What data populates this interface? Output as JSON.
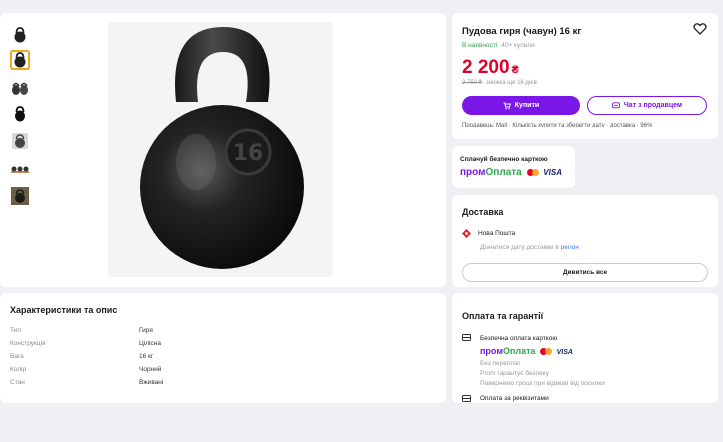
{
  "gallery": {
    "thumbnails": [
      "thumb-1",
      "thumb-2",
      "thumb-3",
      "thumb-4",
      "thumb-5",
      "thumb-6",
      "thumb-7"
    ],
    "main_image_label": "16"
  },
  "product": {
    "title": "Пудова гиря (чавун) 16 кг",
    "in_stock": "В наявності",
    "bought": "40+ купили",
    "price": "2 200",
    "currency": "₴",
    "old_price": "2 750 ₴",
    "discount_note": "знижка ще 16 днів",
    "buy_label": "Купити",
    "chat_label": "Чат з продавцем",
    "cut_text": "Продавець: Mall · Кількість купити та зберегти дату · доставка · 96%"
  },
  "safe_pay": {
    "title": "Сплачуй безпечно карткою",
    "prom_1": "пром",
    "prom_2": "Оплата",
    "visa": "VISA"
  },
  "delivery": {
    "title": "Доставка",
    "carrier": "Нова Пошта",
    "note": "Дізнатися дату доставки в",
    "note_link": "регіон",
    "view_all": "Дивитись все"
  },
  "characteristics": {
    "title": "Характеристики та опис",
    "rows": [
      {
        "k": "Тип",
        "v": "Гиря"
      },
      {
        "k": "Конструкція",
        "v": "Цілісна"
      },
      {
        "k": "Вага",
        "v": "16 кг"
      },
      {
        "k": "Колір",
        "v": "Чорний"
      },
      {
        "k": "Стан",
        "v": "Вживані"
      }
    ]
  },
  "payment": {
    "title": "Оплата та гарантії",
    "card_pay": "Безпечна оплата карткою",
    "prom_1": "пром",
    "prom_2": "Оплата",
    "visa": "VISA",
    "line1": "Без переплат",
    "line2": "Prom гарантує безпеку",
    "line3": "Повернемо гроші при відмові від посилки",
    "requisites": "Оплата за реквізитами"
  },
  "colors": {
    "accent": "#7b16e8",
    "price": "#e0002a",
    "success": "#2fa84f"
  }
}
